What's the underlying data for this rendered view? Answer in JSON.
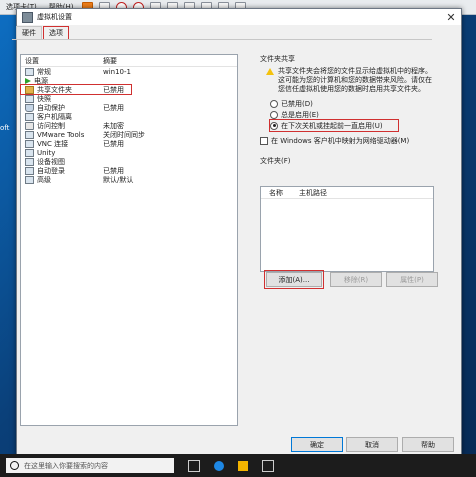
{
  "vm_topbar": {
    "menu_items": [
      "选项卡(T)",
      "帮助(H)"
    ]
  },
  "desktop": {
    "side_text": "oft"
  },
  "dialog": {
    "title": "虚拟机设置",
    "close": "✕",
    "tabs": [
      {
        "label": "硬件"
      },
      {
        "label": "选项"
      }
    ],
    "list": {
      "header": {
        "setting": "设置",
        "summary": "摘要"
      },
      "items": [
        {
          "name": "常规",
          "summary": "win10-1"
        },
        {
          "name": "电源",
          "summary": ""
        },
        {
          "name": "共享文件夹",
          "summary": "已禁用"
        },
        {
          "name": "快照",
          "summary": ""
        },
        {
          "name": "自动保护",
          "summary": "已禁用"
        },
        {
          "name": "客户机隔离",
          "summary": ""
        },
        {
          "name": "访问控制",
          "summary": "未加密"
        },
        {
          "name": "VMware Tools",
          "summary": "关闭时间同步"
        },
        {
          "name": "VNC 连接",
          "summary": "已禁用"
        },
        {
          "name": "Unity",
          "summary": ""
        },
        {
          "name": "设备视图",
          "summary": ""
        },
        {
          "name": "自动登录",
          "summary": "已禁用"
        },
        {
          "name": "高级",
          "summary": "默认/默认"
        }
      ]
    },
    "shared_folders": {
      "title": "文件夹共享",
      "warning": "共享文件夹会将您的文件显示给虚拟机中的程序。这可能为您的计算机和您的数据带来风险。请仅在您信任虚拟机使用您的数据时启用共享文件夹。",
      "options": [
        {
          "label": "已禁用(D)",
          "checked": false
        },
        {
          "label": "总是启用(E)",
          "checked": false
        },
        {
          "label": "在下次关机或挂起前一直启用(U)",
          "checked": true
        }
      ],
      "map_drive": "在 Windows 客户机中映射为网络驱动器(M)"
    },
    "folders": {
      "title": "文件夹(F)",
      "col_name": "名称",
      "col_path": "主机路径",
      "add": "添加(A)...",
      "remove": "移除(R)",
      "properties": "属性(P)"
    },
    "footer": {
      "ok": "确定",
      "cancel": "取消",
      "help": "帮助"
    }
  },
  "taskbar": {
    "search_placeholder": "在这里输入你要搜索的内容"
  }
}
